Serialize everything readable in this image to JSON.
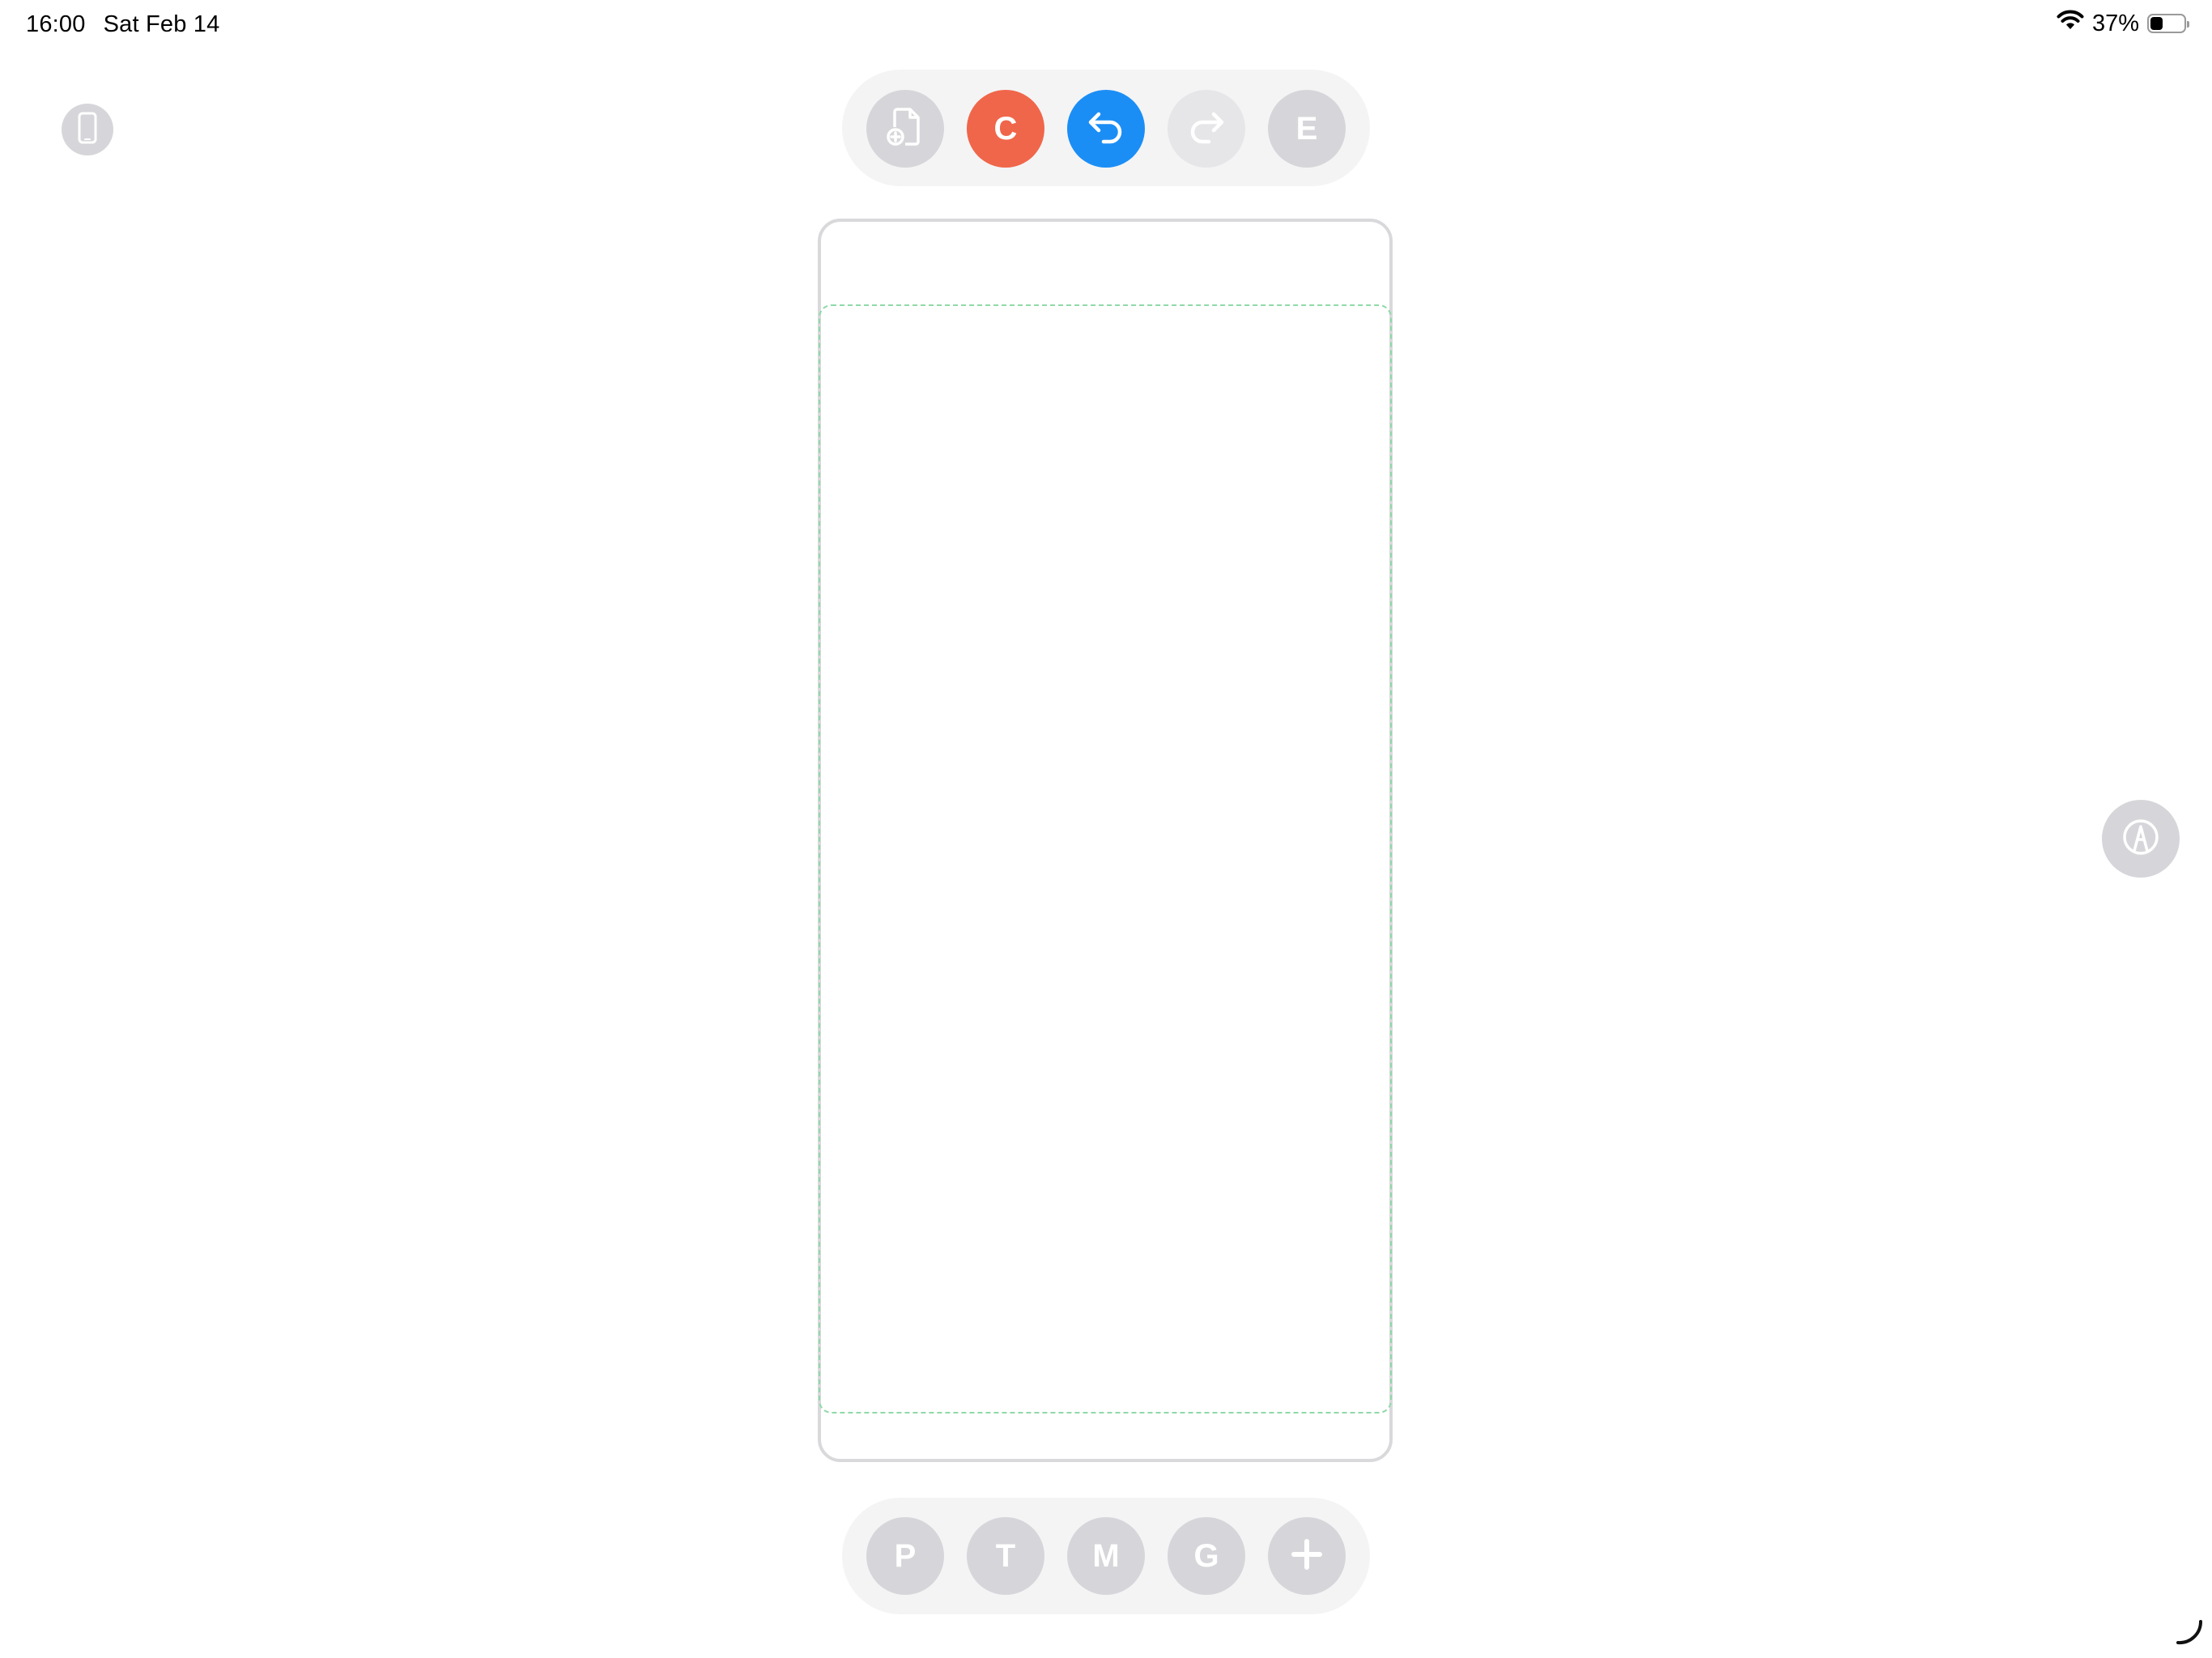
{
  "status_bar": {
    "time": "16:00",
    "date": "Sat Feb 14",
    "battery_percent": "37%",
    "battery_level": 0.37,
    "wifi_icon": "wifi-icon"
  },
  "left_rail": {
    "device_button_icon": "phone-icon"
  },
  "top_toolbar": {
    "new_document_icon": "document-plus-icon",
    "c_label": "C",
    "undo_icon": "undo-icon",
    "redo_icon": "redo-icon",
    "e_label": "E"
  },
  "bottom_toolbar": {
    "p_label": "P",
    "t_label": "T",
    "m_label": "M",
    "g_label": "G",
    "add_icon": "plus-icon"
  },
  "right_rail": {
    "pencil_button_icon": "pencil-circle-icon"
  },
  "colors": {
    "accent_orange": "#f0664a",
    "accent_blue": "#1b8ef5",
    "button_gray": "#d6d6da",
    "safe_area_green": "#8fd9a8"
  }
}
